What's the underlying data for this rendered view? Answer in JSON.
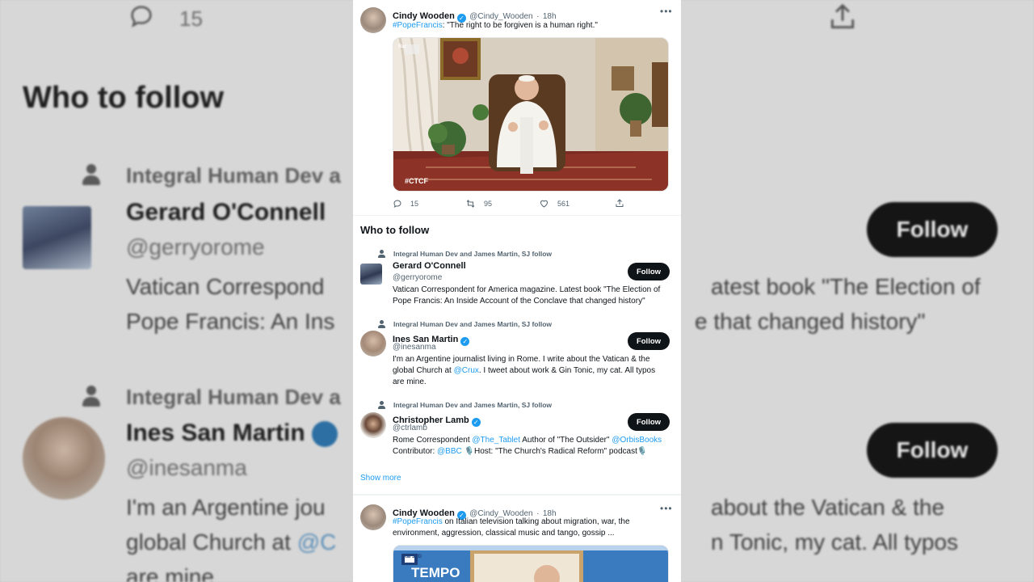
{
  "tweet1": {
    "name": "Cindy Wooden",
    "handle": "@Cindy_Wooden",
    "time": "18h",
    "hashtag": "#PopeFrancis",
    "text": ": \"The right to be forgiven is a human right.\"",
    "media_tag": "#CTCF",
    "media_logo": "Rai",
    "replies": "15",
    "retweets": "95",
    "likes": "561"
  },
  "who_to_follow": {
    "title": "Who to follow",
    "users": [
      {
        "context": "Integral Human Dev and James Martin, SJ follow",
        "name": "Gerard O'Connell",
        "handle": "@gerryorome",
        "bio": "Vatican Correspondent for America magazine. Latest book \"The Election of Pope Francis: An Inside Account of the Conclave that changed history\"",
        "follow_label": "Follow"
      },
      {
        "context": "Integral Human Dev and James Martin, SJ follow",
        "name": "Ines San Martin",
        "handle": "@inesanma",
        "bio_1": "I'm an Argentine journalist living in Rome. I write about the Vatican & the global Church at ",
        "bio_link": "@Crux",
        "bio_2": ". I tweet about work & Gin Tonic, my cat. All typos are mine.",
        "follow_label": "Follow"
      },
      {
        "context": "Integral Human Dev and James Martin, SJ follow",
        "name": "Christopher Lamb",
        "handle": "@ctrlamb",
        "bio_1": "Rome Correspondent ",
        "bio_link_1": "@The_Tablet",
        "bio_2": " Author of \"The Outsider\" ",
        "bio_link_2": "@OrbisBooks",
        "bio_3": "Contributor: ",
        "bio_link_3": "@BBC",
        "bio_4": " 🎙️Host: \"The Church's Radical Reform\" podcast🎙️",
        "follow_label": "Follow"
      }
    ],
    "show_more": "Show more"
  },
  "tweet2": {
    "name": "Cindy Wooden",
    "handle": "@Cindy_Wooden",
    "time": "18h",
    "hashtag": "#PopeFrancis",
    "text_1": " on Italian television talking about migration, war, the",
    "text_2": "environment, aggression, classical music and tango, gossip ...",
    "media_logo": "Rai 3HD",
    "media_caption": "TEMPO"
  },
  "background": {
    "replies": "15",
    "title": "Who to follow",
    "context_1": "Integral Human Dev a",
    "name_1": "Gerard O'Connell",
    "handle_1": "@gerryorome",
    "bio_1_left_a": "Vatican Correspond",
    "bio_1_right_a": "atest book \"The Election of",
    "bio_1_left_b": "Pope Francis: An Ins",
    "bio_1_right_b": "e that changed history\"",
    "context_2": "Integral Human Dev a",
    "name_2": "Ines San Martin",
    "handle_2": "@inesanma",
    "bio_2_left_a": "I'm an Argentine jou",
    "bio_2_right_a": "about the Vatican & the",
    "bio_2_left_b": "global Church at ",
    "bio_2_link": "@C",
    "bio_2_right_b": "n Tonic, my cat. All typos",
    "bio_2_left_c": "are mine.",
    "follow_label": "Follow"
  }
}
